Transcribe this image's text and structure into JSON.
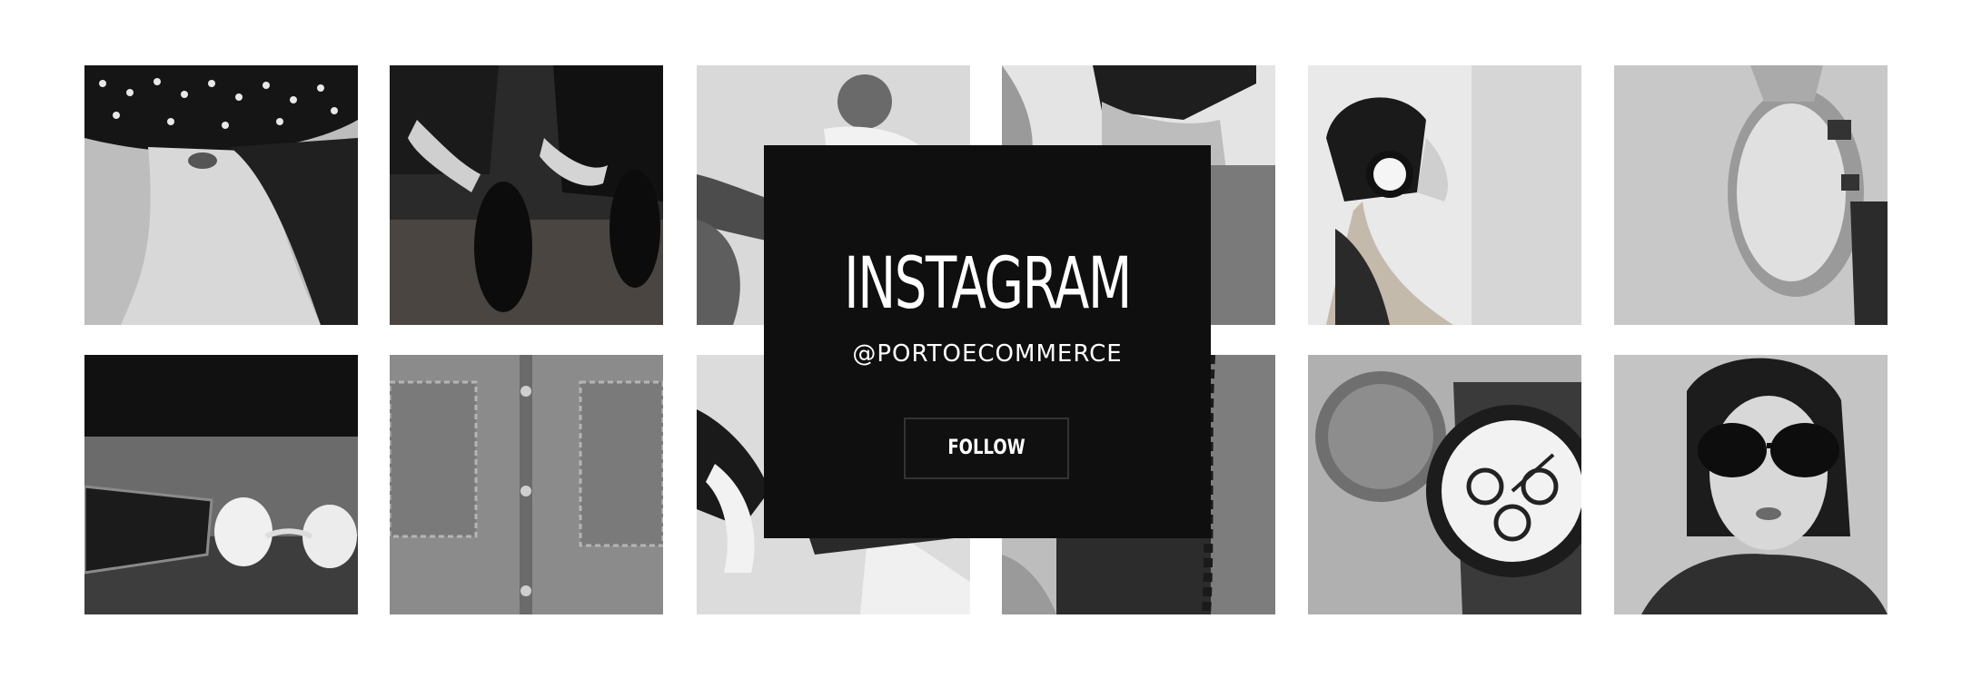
{
  "instagram": {
    "title": "INSTAGRAM",
    "handle": "@PORTOECOMMERCE",
    "follow_label": "FOLLOW"
  },
  "photos": [
    {
      "subject": "woman in polka dot hat"
    },
    {
      "subject": "man tying dress shoes"
    },
    {
      "subject": "man sitting in jeans"
    },
    {
      "subject": "man in jeans torso"
    },
    {
      "subject": "woman with headphones"
    },
    {
      "subject": "wristwatch close-up"
    },
    {
      "subject": "phone and earbuds"
    },
    {
      "subject": "denim shirt pockets"
    },
    {
      "subject": "person lying on floor"
    },
    {
      "subject": "jeans with chain"
    },
    {
      "subject": "chronograph watches"
    },
    {
      "subject": "woman in sunglasses"
    }
  ],
  "colors": {
    "panel": "#0f0f0f",
    "text": "#ffffff",
    "button_border": "#333333"
  }
}
